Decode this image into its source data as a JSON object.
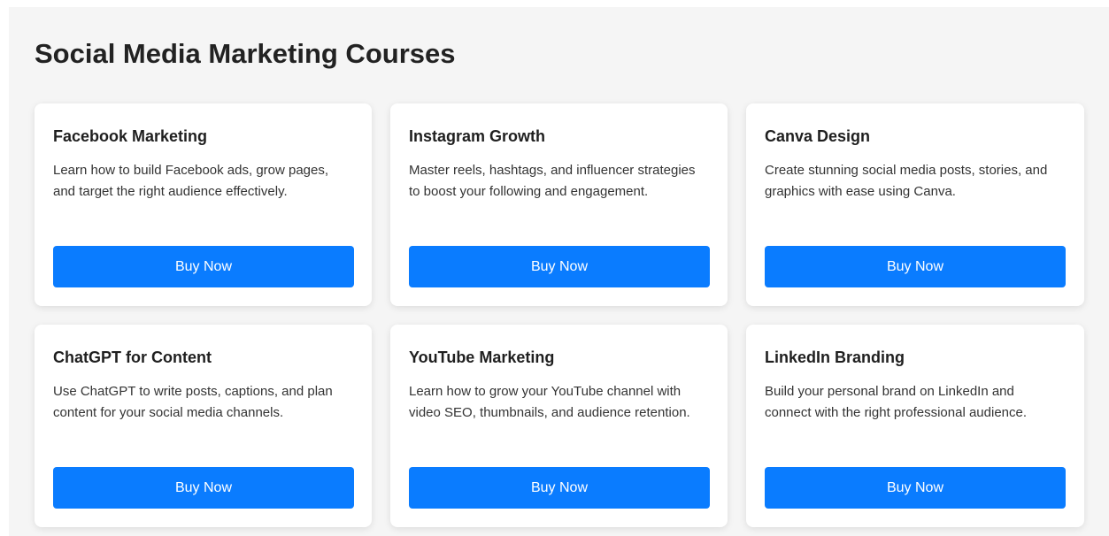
{
  "page": {
    "title": "Social Media Marketing Courses"
  },
  "colors": {
    "page_background": "#f5f5f5",
    "card_background": "#ffffff",
    "button_background": "#0a7cff",
    "button_text": "#ffffff"
  },
  "courses": [
    {
      "title": "Facebook Marketing",
      "description": "Learn how to build Facebook ads, grow pages, and target the right audience effectively.",
      "button_label": "Buy Now"
    },
    {
      "title": "Instagram Growth",
      "description": "Master reels, hashtags, and influencer strategies to boost your following and engagement.",
      "button_label": "Buy Now"
    },
    {
      "title": "Canva Design",
      "description": "Create stunning social media posts, stories, and graphics with ease using Canva.",
      "button_label": "Buy Now"
    },
    {
      "title": "ChatGPT for Content",
      "description": "Use ChatGPT to write posts, captions, and plan content for your social media channels.",
      "button_label": "Buy Now"
    },
    {
      "title": "YouTube Marketing",
      "description": "Learn how to grow your YouTube channel with video SEO, thumbnails, and audience retention.",
      "button_label": "Buy Now"
    },
    {
      "title": "LinkedIn Branding",
      "description": "Build your personal brand on LinkedIn and connect with the right professional audience.",
      "button_label": "Buy Now"
    }
  ]
}
